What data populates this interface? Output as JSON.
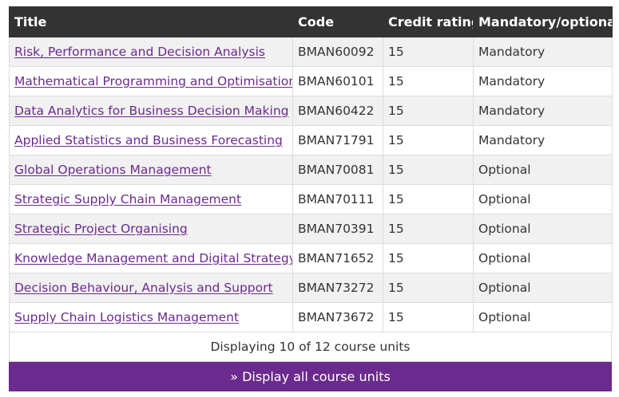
{
  "table": {
    "headers": {
      "title": "Title",
      "code": "Code",
      "credit": "Credit rating",
      "mandatory": "Mandatory/optional"
    },
    "rows": [
      {
        "title": "Risk, Performance and Decision Analysis",
        "code": "BMAN60092",
        "credit": "15",
        "mandatory": "Mandatory"
      },
      {
        "title": "Mathematical Programming and Optimisation",
        "code": "BMAN60101",
        "credit": "15",
        "mandatory": "Mandatory"
      },
      {
        "title": "Data Analytics for Business Decision Making",
        "code": "BMAN60422",
        "credit": "15",
        "mandatory": "Mandatory"
      },
      {
        "title": "Applied Statistics and Business Forecasting",
        "code": "BMAN71791",
        "credit": "15",
        "mandatory": "Mandatory"
      },
      {
        "title": "Global Operations Management",
        "code": "BMAN70081",
        "credit": "15",
        "mandatory": "Optional"
      },
      {
        "title": "Strategic Supply Chain Management",
        "code": "BMAN70111",
        "credit": "15",
        "mandatory": "Optional"
      },
      {
        "title": "Strategic Project Organising",
        "code": "BMAN70391",
        "credit": "15",
        "mandatory": "Optional"
      },
      {
        "title": "Knowledge Management and Digital Strategy",
        "code": "BMAN71652",
        "credit": "15",
        "mandatory": "Optional"
      },
      {
        "title": "Decision Behaviour, Analysis and Support",
        "code": "BMAN73272",
        "credit": "15",
        "mandatory": "Optional"
      },
      {
        "title": "Supply Chain Logistics Management",
        "code": "BMAN73672",
        "credit": "15",
        "mandatory": "Optional"
      }
    ]
  },
  "footer": {
    "count_text": "Displaying 10 of 12 course units",
    "display_all_label": "» Display all course units"
  },
  "colors": {
    "header_bg": "#333333",
    "link": "#6c2a8e",
    "button_bg": "#6b2a8d",
    "row_alt": "#f1f1f1"
  }
}
